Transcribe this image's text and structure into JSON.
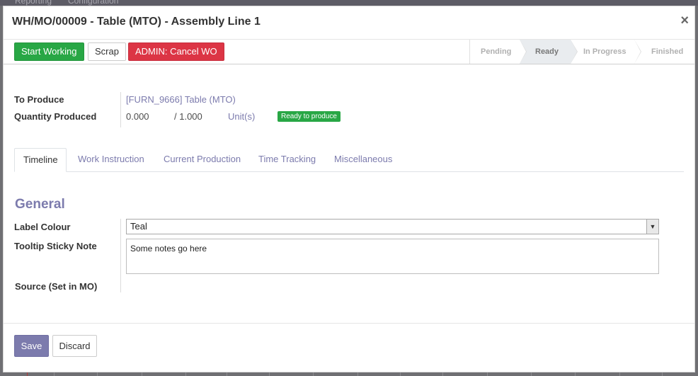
{
  "backdrop": {
    "menu_items": [
      "Reporting",
      "Configuration"
    ]
  },
  "header": {
    "title": "WH/MO/00009 - Table (MTO) - Assembly Line 1",
    "close_symbol": "×"
  },
  "toolbar": {
    "start_label": "Start Working",
    "scrap_label": "Scrap",
    "cancel_label": "ADMIN: Cancel WO"
  },
  "stages": [
    {
      "label": "Pending",
      "active": false
    },
    {
      "label": "Ready",
      "active": true
    },
    {
      "label": "In Progress",
      "active": false
    },
    {
      "label": "Finished",
      "active": false
    }
  ],
  "form": {
    "to_produce_label": "To Produce",
    "to_produce_value": "[FURN_9666] Table (MTO)",
    "qty_label": "Quantity Produced",
    "qty_produced": "0.000",
    "qty_total": "/ 1.000",
    "uom": "Unit(s)",
    "status_badge": "Ready to produce"
  },
  "tabs": [
    {
      "label": "Timeline",
      "active": true
    },
    {
      "label": "Work Instruction",
      "active": false
    },
    {
      "label": "Current Production",
      "active": false
    },
    {
      "label": "Time Tracking",
      "active": false
    },
    {
      "label": "Miscellaneous",
      "active": false
    }
  ],
  "general": {
    "section_title": "General",
    "label_colour_label": "Label Colour",
    "label_colour_value": "Teal",
    "tooltip_label": "Tooltip Sticky Note",
    "tooltip_value": "Some notes go here",
    "source_label": "Source (Set in MO)",
    "source_value": ""
  },
  "footer": {
    "save_label": "Save",
    "discard_label": "Discard"
  },
  "colors": {
    "primary": "#7c7bad",
    "success": "#28a745",
    "danger": "#dc3545"
  },
  "icons": {
    "close": "close-icon",
    "select_arrow": "chevron-down-icon"
  }
}
